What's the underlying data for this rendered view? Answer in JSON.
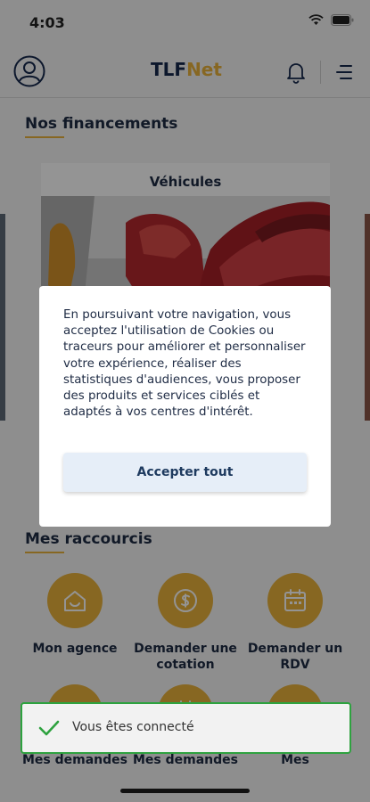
{
  "status_bar": {
    "time": "4:03"
  },
  "header": {
    "logo_part1": "TLF",
    "logo_part2": "Net"
  },
  "financements": {
    "title": "Nos financements",
    "card_title": "Véhicules"
  },
  "shortcuts": {
    "title": "Mes raccourcis",
    "items": [
      {
        "label": "Mon agence",
        "icon": "agency-icon"
      },
      {
        "label": "Demander une cotation",
        "icon": "dollar-icon"
      },
      {
        "label": "Demander un RDV",
        "icon": "calendar-icon"
      },
      {
        "label": "Mes demandes",
        "icon": "folder-icon"
      },
      {
        "label": "Mes demandes",
        "icon": "calendar-icon"
      },
      {
        "label": "Mes",
        "icon": "folder-icon"
      }
    ]
  },
  "cookie_modal": {
    "text": "En poursuivant votre navigation, vous acceptez l'utilisation de Cookies ou traceurs pour améliorer et personnaliser votre expérience, réaliser des statistiques d'audiences, vous proposer des produits et services ciblés et adaptés à vos centres d'intérêt.",
    "accept_label": "Accepter tout"
  },
  "toast": {
    "message": "Vous êtes connecté"
  },
  "colors": {
    "accent": "#e8b13b",
    "navy": "#1e2b44",
    "success": "#2ea23f"
  }
}
